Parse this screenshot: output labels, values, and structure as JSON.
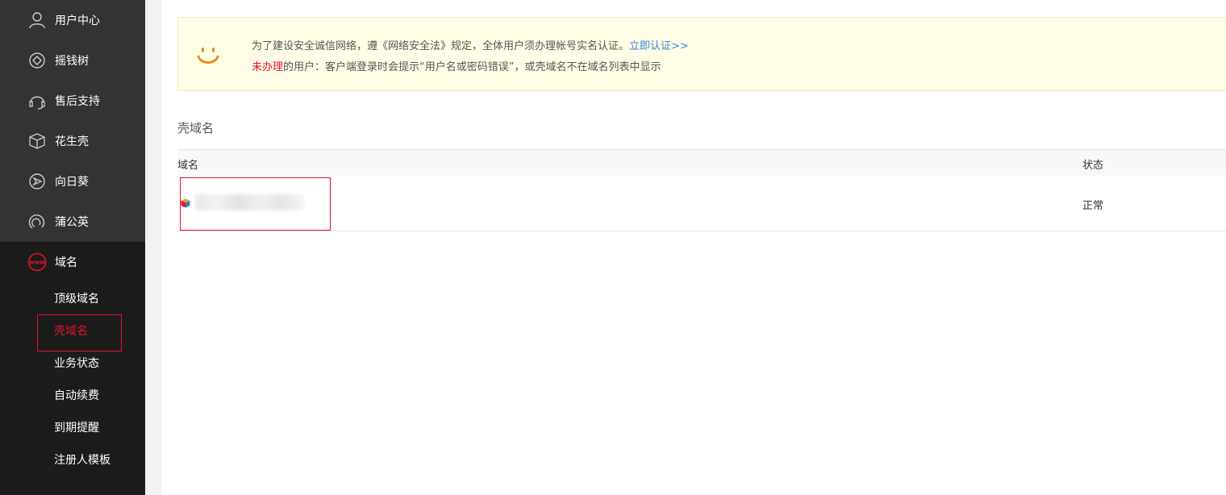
{
  "sidebar": {
    "top_items": [
      {
        "label": "用户中心",
        "icon": "user-icon"
      },
      {
        "label": "摇钱树",
        "icon": "diamond-icon"
      },
      {
        "label": "售后支持",
        "icon": "headset-icon"
      },
      {
        "label": "花生壳",
        "icon": "box-icon"
      },
      {
        "label": "向日葵",
        "icon": "sunflower-icon"
      },
      {
        "label": "蒲公英",
        "icon": "dandelion-icon"
      }
    ],
    "domain_item": {
      "label": "域名",
      "icon": "www-icon"
    },
    "sub_items": [
      {
        "label": "顶级域名"
      },
      {
        "label": "壳域名"
      },
      {
        "label": "业务状态"
      },
      {
        "label": "自动续费"
      },
      {
        "label": "到期提醒"
      },
      {
        "label": "注册人模板"
      }
    ]
  },
  "notice": {
    "line1_text": "为了建设安全诚信网络，遵《网络安全法》规定，全体用户须办理帐号实名认证。",
    "line1_link": "立即认证>>",
    "line2_red": "未办理",
    "line2_text": "的用户：客户端登录时会提示“用户名或密码错误”，或壳域名不在域名列表中显示"
  },
  "section": {
    "title": "壳域名"
  },
  "table": {
    "headers": {
      "domain": "域名",
      "status": "状态"
    },
    "rows": [
      {
        "status": "正常"
      }
    ]
  },
  "colors": {
    "accent": "#e2132c",
    "link": "#3b84d9",
    "sidebar_bg": "#1c1c1c",
    "notice_bg": "#fffde6"
  }
}
